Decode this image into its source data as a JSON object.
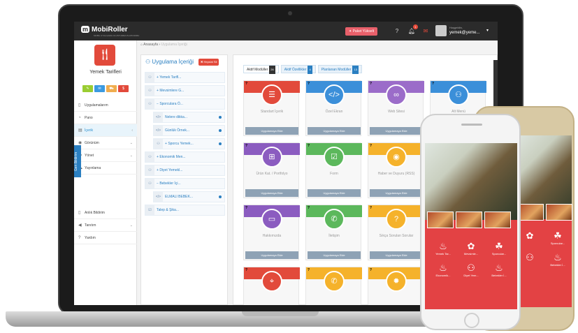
{
  "topbar": {
    "brand": "MobiRoller",
    "brand_sub": "MOBIL UYGULAMA OLUSTURMA PLATFORMU",
    "store_button": "Paket Yükselt",
    "help": "?",
    "notif_count": "1",
    "greeting": "Hoşgeldin,",
    "user_email": "yemek@yeme..."
  },
  "sidebar": {
    "app_name": "Yemek Tarifleri",
    "vertical_tab": "Geri Bildirim",
    "items": [
      {
        "label": "Uygulamalarım",
        "icon": "mobile-icon"
      },
      {
        "label": "Pano",
        "icon": "dashboard-icon"
      },
      {
        "label": "İçerik",
        "icon": "content-icon",
        "active": true
      },
      {
        "label": "Görünüm",
        "icon": "eye-icon"
      },
      {
        "label": "Yönet",
        "icon": "manage-icon"
      },
      {
        "label": "Yayınlama",
        "icon": "cloud-icon"
      }
    ],
    "items2": [
      {
        "label": "Anlık Bildirim",
        "icon": "push-icon"
      },
      {
        "label": "Tanıtım",
        "icon": "megaphone-icon"
      },
      {
        "label": "Yardım",
        "icon": "help-icon"
      }
    ]
  },
  "breadcrumb": {
    "home": "Anasayfa",
    "current": "Uygulama İçeriği"
  },
  "left_panel": {
    "title": "Uygulama İçeriği",
    "delete_button": "Hepsini Sil",
    "tree": [
      {
        "label": "Yemek Tarifl...",
        "level": 0,
        "kind": "sitemap"
      },
      {
        "label": "Mevsimlere G...",
        "level": 0,
        "kind": "sitemap"
      },
      {
        "label": "Sporculara Ö...",
        "level": 0,
        "kind": "sitemap",
        "open": true
      },
      {
        "label": "Nelere dikka...",
        "level": 1,
        "kind": "code",
        "dot": true
      },
      {
        "label": "Günlük Örnek...",
        "level": 1,
        "kind": "code",
        "dot": true
      },
      {
        "label": "Sporcu Yemek...",
        "level": 1,
        "kind": "sitemap",
        "dot": true
      },
      {
        "label": "Ekonomik Men...",
        "level": 0,
        "kind": "sitemap"
      },
      {
        "label": "Diyet Yemekl...",
        "level": 0,
        "kind": "sitemap"
      },
      {
        "label": "Bebekler İçi...",
        "level": 0,
        "kind": "sitemap",
        "open": true
      },
      {
        "label": "ELMALI BEBEK...",
        "level": 1,
        "kind": "code",
        "dot": true
      },
      {
        "label": "Talep & Şika...",
        "level": 0,
        "kind": "check"
      }
    ]
  },
  "right_panel": {
    "tabs": [
      {
        "label": "Aktif Modüller",
        "badge": "26",
        "active": true
      },
      {
        "label": "Aktif Özellikler",
        "badge": "4"
      },
      {
        "label": "Planlanan Modüller",
        "badge": "13"
      }
    ],
    "use_label": "Uygulamaya Ekle",
    "modules": [
      {
        "name": "Standart İçerik",
        "color": "#e24a3b",
        "icon": "list-icon",
        "glyph": "☰"
      },
      {
        "name": "Özel Ekran",
        "color": "#3b8fd9",
        "icon": "code-icon",
        "glyph": "</>"
      },
      {
        "name": "Web Sitesi",
        "color": "#9b6cc9",
        "icon": "link-icon",
        "glyph": "∞"
      },
      {
        "name": "Alt Menü",
        "color": "#3b8fd9",
        "icon": "sitemap-icon",
        "glyph": "⚇"
      },
      {
        "name": "Ürün Kat. / Portfolyo",
        "color": "#8b5cc0",
        "icon": "grid-icon",
        "glyph": "⊞"
      },
      {
        "name": "Form",
        "color": "#5cb85c",
        "icon": "checkbox-icon",
        "glyph": "☑"
      },
      {
        "name": "Haber ve Duyuru (RSS)",
        "color": "#f5b22b",
        "icon": "rss-icon",
        "glyph": "◉"
      },
      {
        "name": "",
        "color": "#f5b22b",
        "icon": "",
        "glyph": ""
      },
      {
        "name": "Hakkımızda",
        "color": "#8b5cc0",
        "icon": "tablet-icon",
        "glyph": "▭"
      },
      {
        "name": "İletişim",
        "color": "#5cb85c",
        "icon": "phone-icon",
        "glyph": "✆"
      },
      {
        "name": "Sıkça Sorulan Sorular",
        "color": "#f5b22b",
        "icon": "question-icon",
        "glyph": "?"
      },
      {
        "name": "",
        "color": "#f5b22b",
        "icon": "",
        "glyph": ""
      },
      {
        "name": "",
        "color": "#e24a3b",
        "icon": "map-pin-icon",
        "glyph": "⌖"
      },
      {
        "name": "",
        "color": "#f5b22b",
        "icon": "phone-icon",
        "glyph": "✆"
      },
      {
        "name": "",
        "color": "#f5b22b",
        "icon": "gear-icon",
        "glyph": "✹"
      }
    ]
  },
  "phone_front": {
    "grid": [
      {
        "label": "Yemek Tar...",
        "glyph": "♨"
      },
      {
        "label": "Mevsimle...",
        "glyph": "✿"
      },
      {
        "label": "Sporcular...",
        "glyph": "☘"
      },
      {
        "label": "Ekonomik...",
        "glyph": "♨"
      },
      {
        "label": "Diyet Yem...",
        "glyph": "⚇"
      },
      {
        "label": "Bebekler İ...",
        "glyph": "♨"
      }
    ]
  },
  "phone_back": {
    "grid": [
      {
        "label": "",
        "glyph": "✿"
      },
      {
        "label": "Sporcular...",
        "glyph": "☘"
      },
      {
        "label": "",
        "glyph": "⚇"
      },
      {
        "label": "Bebekler İ...",
        "glyph": "♨"
      }
    ]
  }
}
